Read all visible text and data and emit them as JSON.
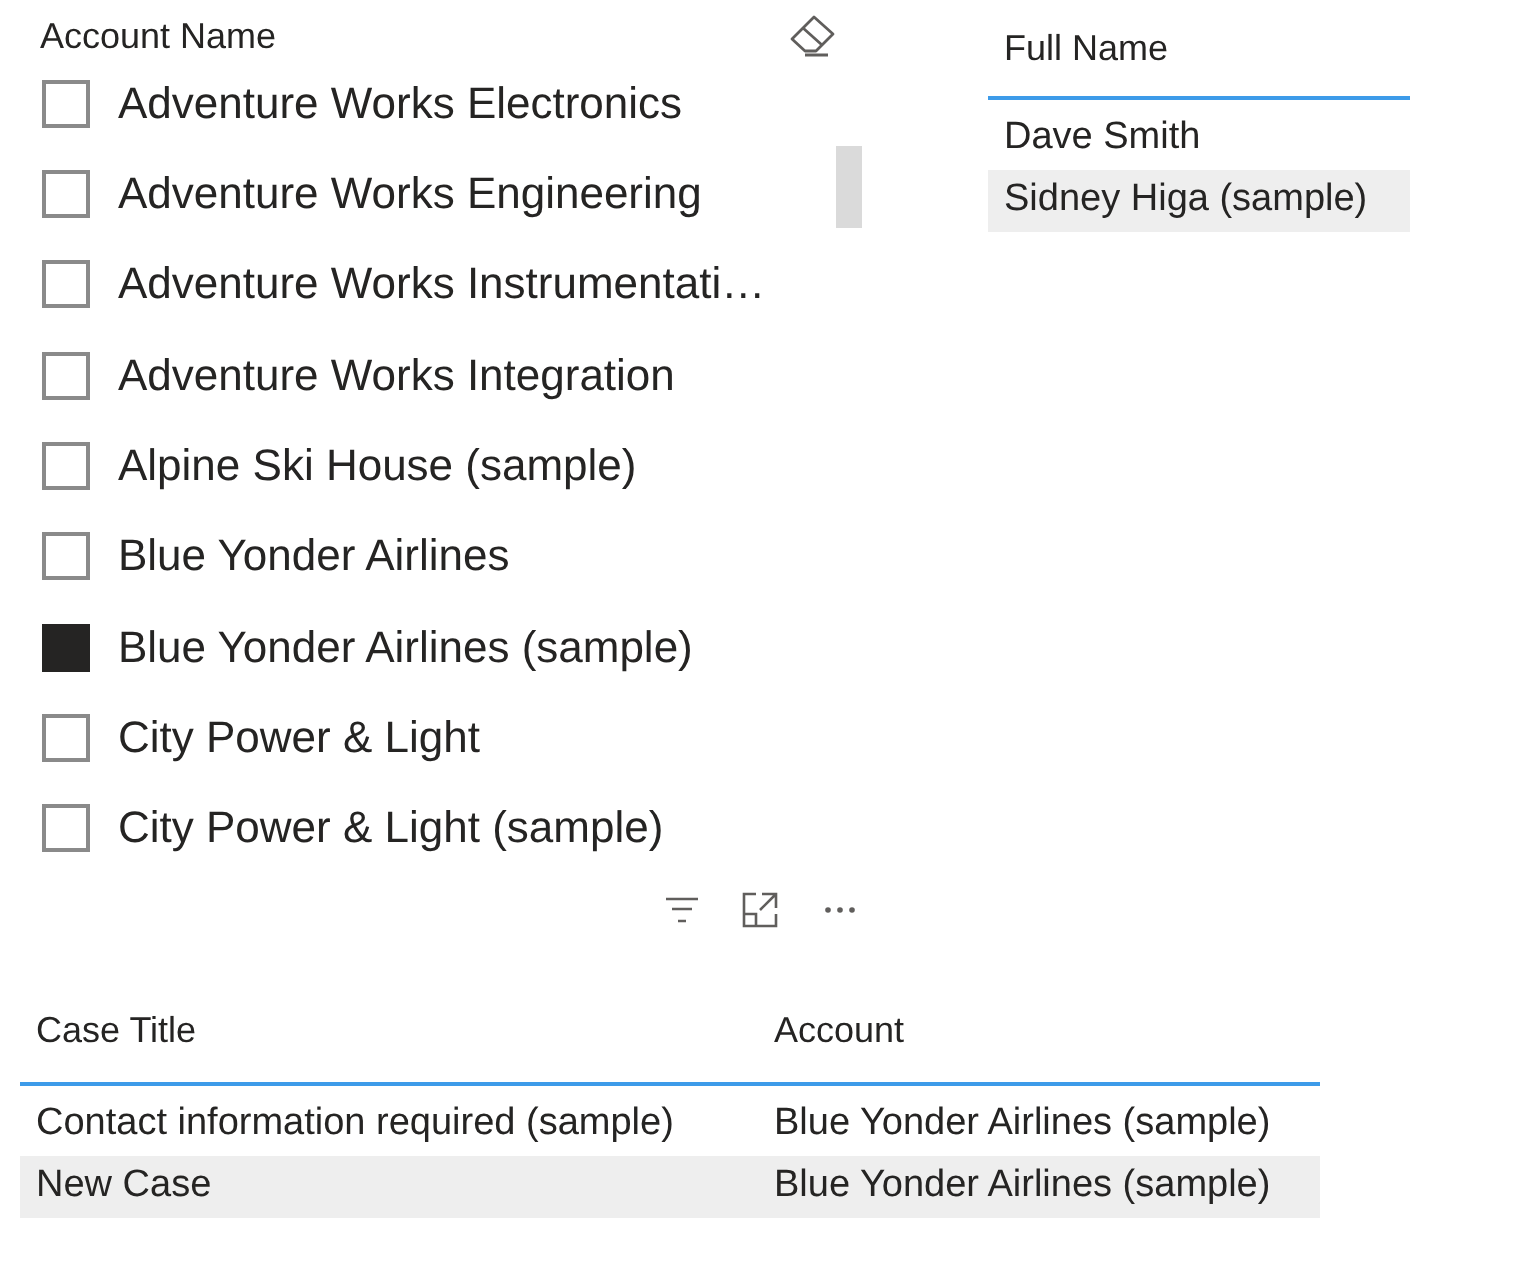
{
  "slicer": {
    "title": "Account Name",
    "items": [
      {
        "label": "Adventure Works Electronics",
        "checked": false
      },
      {
        "label": "Adventure Works Engineering",
        "checked": false
      },
      {
        "label": "Adventure Works Instrumentati…",
        "checked": false
      },
      {
        "label": "Adventure Works Integration",
        "checked": false
      },
      {
        "label": "Alpine Ski House (sample)",
        "checked": false
      },
      {
        "label": "Blue Yonder Airlines",
        "checked": false
      },
      {
        "label": "Blue Yonder Airlines (sample)",
        "checked": true
      },
      {
        "label": "City Power & Light",
        "checked": false
      },
      {
        "label": "City Power & Light (sample)",
        "checked": false
      }
    ]
  },
  "contacts_table": {
    "columns": [
      "Full Name"
    ],
    "rows": [
      [
        "Dave Smith"
      ],
      [
        "Sidney Higa (sample)"
      ]
    ]
  },
  "cases_table": {
    "columns": [
      "Case Title",
      "Account"
    ],
    "rows": [
      [
        "Contact information required (sample)",
        "Blue Yonder Airlines (sample)"
      ],
      [
        "New Case",
        "Blue Yonder Airlines (sample)"
      ]
    ]
  }
}
